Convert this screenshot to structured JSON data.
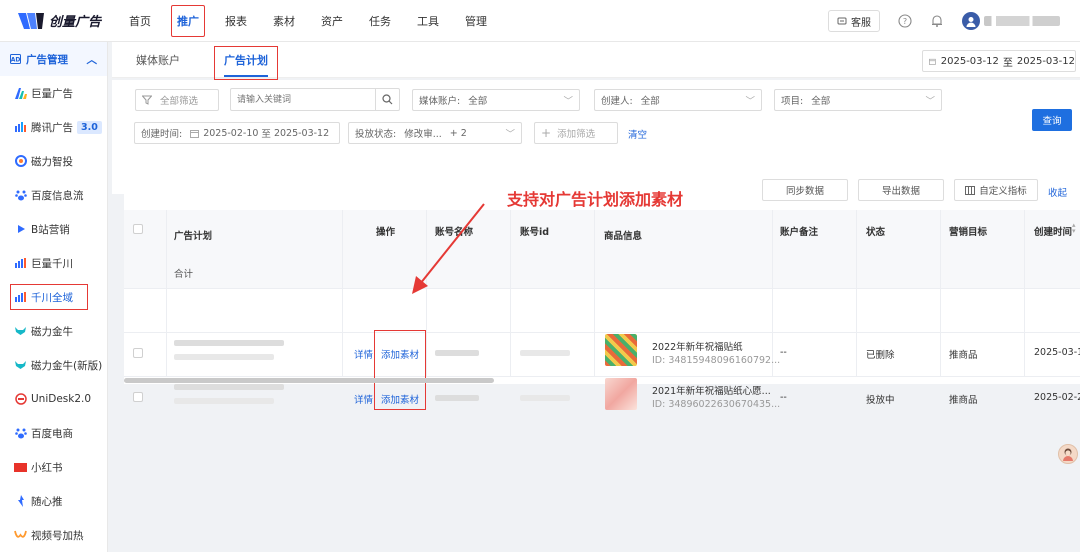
{
  "brand": {
    "name": "创量广告"
  },
  "topnav": [
    {
      "label": "首页"
    },
    {
      "label": "推广",
      "active": true
    },
    {
      "label": "报表"
    },
    {
      "label": "素材"
    },
    {
      "label": "资产"
    },
    {
      "label": "任务"
    },
    {
      "label": "工具"
    },
    {
      "label": "管理"
    }
  ],
  "topright": {
    "service_label": "客服"
  },
  "sidebar": {
    "header": "广告管理",
    "items": [
      {
        "label": "巨量广告",
        "icon": "juliang-icon"
      },
      {
        "label": "腾讯广告",
        "icon": "tencent-icon",
        "badge": "3.0"
      },
      {
        "label": "磁力智投",
        "icon": "cili-icon"
      },
      {
        "label": "百度信息流",
        "icon": "baidu-icon"
      },
      {
        "label": "B站营销",
        "icon": "bilibili-icon"
      },
      {
        "label": "巨量千川",
        "icon": "qianchuan-icon"
      },
      {
        "label": "千川全域",
        "icon": "qianchuan-icon",
        "highlighted": true
      },
      {
        "label": "磁力金牛",
        "icon": "jinniu-icon"
      },
      {
        "label": "磁力金牛(新版)",
        "icon": "jinniu-icon"
      },
      {
        "label": "UniDesk2.0",
        "icon": "unidesk-icon"
      },
      {
        "label": "百度电商",
        "icon": "baidu-icon"
      },
      {
        "label": "小红书",
        "icon": "xiaohongshu-icon"
      },
      {
        "label": "随心推",
        "icon": "suixintui-icon"
      },
      {
        "label": "视频号加热",
        "icon": "shipinhao-icon"
      }
    ]
  },
  "tabs": [
    {
      "label": "媒体账户"
    },
    {
      "label": "广告计划",
      "active": true
    }
  ],
  "date_range": {
    "start": "2025-03-12",
    "sep": "至",
    "end": "2025-03-12"
  },
  "filters": {
    "all_filter": "全部筛选",
    "keyword_placeholder": "请输入关键词",
    "media_account_label": "媒体账户:",
    "media_account_value": "全部",
    "creator_label": "创建人:",
    "creator_value": "全部",
    "project_label": "项目:",
    "project_value": "全部",
    "created_time_label": "创建时间:",
    "created_start": "2025-02-10",
    "created_sep": "至",
    "created_end": "2025-03-12",
    "status_label": "投放状态:",
    "status_value": "修改审...",
    "status_more": "+ 2",
    "add_filter": "添加筛选",
    "clear": "清空",
    "query": "查询"
  },
  "table_actions": {
    "sync": "同步数据",
    "export": "导出数据",
    "custom_metrics": "自定义指标",
    "collapse": "收起"
  },
  "columns": [
    "广告计划",
    "操作",
    "账号名称",
    "账号id",
    "商品信息",
    "账户备注",
    "状态",
    "营销目标",
    "创建时间"
  ],
  "total_label": "合计",
  "rows": [
    {
      "action_detail": "详情",
      "action_add": "添加素材",
      "product_title": "2022年新年祝福贴纸",
      "product_id": "ID: 34815948096160792...",
      "remark": "--",
      "status": "已删除",
      "goal": "推商品",
      "created": "2025-03-1"
    },
    {
      "action_detail": "详情",
      "action_add": "添加素材",
      "product_title": "2021年新年祝福贴纸心愿...",
      "product_id": "ID: 34896022630670435...",
      "remark": "--",
      "status": "投放中",
      "goal": "推商品",
      "created": "2025-02-2"
    }
  ],
  "annotation": "支持对广告计划添加素材",
  "colors": {
    "accent": "#1e63d9",
    "highlight": "#e53935"
  }
}
